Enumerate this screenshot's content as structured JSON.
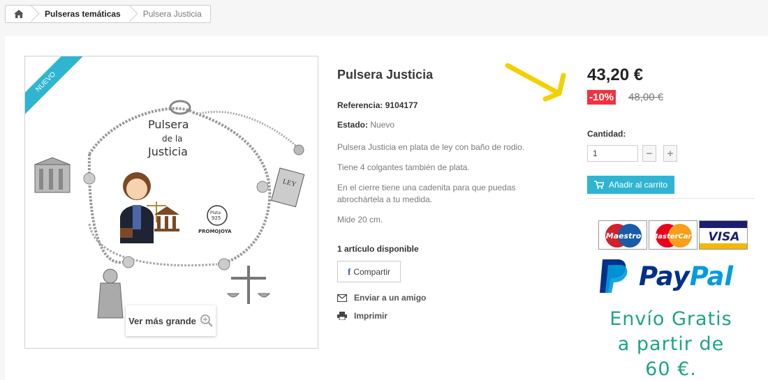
{
  "breadcrumb": {
    "items": [
      "Pulseras temáticas",
      "Pulsera Justicia"
    ]
  },
  "product": {
    "badge": "NUEVO",
    "zoom_label": "Ver más grande",
    "title": "Pulsera Justicia",
    "ref_label": "Referencia:",
    "ref_value": "9104177",
    "estado_label": "Estado:",
    "estado_value": "Nuevo",
    "description": [
      "Pulsera Justicia en plata de ley con baño de rodio.",
      "Tiene 4 colgantes también de plata.",
      "En el cierre tiene una cadenita para que puedas abrochártela a tu medida.",
      "Mide 20 cm."
    ],
    "availability": "1 artículo disponible",
    "share_label": "Compartir",
    "share_icon_glyph": "f",
    "send_friend_label": "Enviar a un amigo",
    "print_label": "Imprimir"
  },
  "image_text": {
    "line1": "Pulsera",
    "line2": "de la",
    "line3": "Justicia",
    "plata": "Plata",
    "plata_num": "925",
    "brand": "PROMOJOYA",
    "ley": "LEY"
  },
  "pricing": {
    "price": "43,20 €",
    "discount": "-10%",
    "old_price": "48,00 €",
    "qty_label": "Cantidad:",
    "qty_value": "1",
    "minus": "−",
    "plus": "+",
    "add_to_cart": "Añadir al carrito"
  },
  "payments": {
    "cards": [
      "Maestro",
      "MasterCard",
      "VISA"
    ],
    "paypal": "PayPal",
    "paypal_first": "Pay",
    "paypal_second": "Pal",
    "shipping_promo": [
      "Envío Gratis",
      "a partir de",
      "60 €."
    ]
  },
  "colors": {
    "accent": "#2fb5d2",
    "discount": "#f13340",
    "promo_green": "#1ea485",
    "paypal_dark": "#003087",
    "paypal_light": "#009cde",
    "arrow": "#f5d000"
  }
}
